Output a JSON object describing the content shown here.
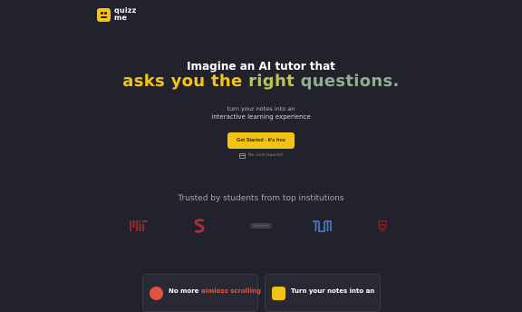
{
  "brand": {
    "name_line1": "quizz",
    "name_line2": "me",
    "logo_icon": "robot-face-icon",
    "accent": "#f3c316"
  },
  "hero": {
    "line1": "Imagine an AI tutor that",
    "line2_words": [
      "asks",
      "you",
      "the",
      "right",
      "questions."
    ],
    "subtitle_line1": "turn your notes into an",
    "subtitle_line2": "interactive learning experience"
  },
  "cta": {
    "label": "Get Started - It's free",
    "note": "No card required",
    "note_icon": "credit-card-icon"
  },
  "trusted": {
    "heading": "Trusted by students from top institutions",
    "logos": [
      "MIT",
      "Stanford",
      "UCL",
      "TUM",
      "Harvard"
    ]
  },
  "features": [
    {
      "title_prefix": "No more ",
      "title_highlight": "aimless scrolling",
      "icon": "x-circle-icon"
    },
    {
      "title": "Turn your notes into an",
      "icon": "robot-face-icon"
    }
  ],
  "colors": {
    "background": "#22222d",
    "yellow": "#f3c316",
    "olive": "#bcc15a",
    "teal": "#8fae8d",
    "red": "#e0553b"
  }
}
